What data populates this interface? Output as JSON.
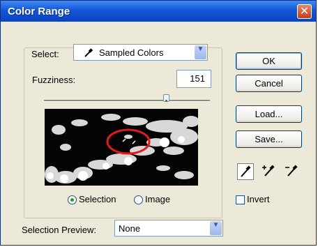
{
  "window": {
    "title": "Color Range",
    "close_label": "✕"
  },
  "select": {
    "label": "Select:",
    "value": "Sampled Colors"
  },
  "fuzziness": {
    "label": "Fuzziness:",
    "value": "151"
  },
  "preview_mode": {
    "selection_label": "Selection",
    "image_label": "Image",
    "selected": "Selection"
  },
  "buttons": {
    "ok": "OK",
    "cancel": "Cancel",
    "load": "Load...",
    "save": "Save..."
  },
  "invert": {
    "label": "Invert",
    "checked": false
  },
  "selection_preview": {
    "label": "Selection Preview:",
    "value": "None"
  },
  "colors": {
    "title_bar": "#1656d6",
    "dialog_bg": "#ece9d8",
    "selection_circle": "#e31b1b"
  }
}
